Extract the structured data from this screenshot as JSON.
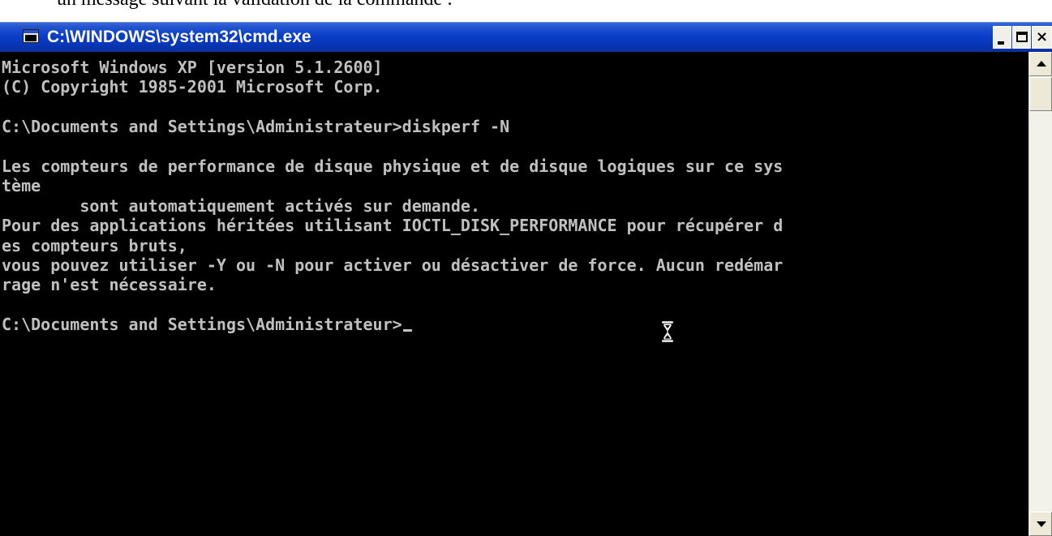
{
  "document": {
    "caption": "un message suivant la validation de la commande :"
  },
  "window": {
    "title": "C:\\WINDOWS\\system32\\cmd.exe",
    "icon": "console-window-icon",
    "controls": {
      "minimize": "minimize-icon",
      "maximize": "maximize-icon",
      "close": "×"
    }
  },
  "console": {
    "lines": [
      "Microsoft Windows XP [version 5.1.2600]",
      "(C) Copyright 1985-2001 Microsoft Corp.",
      "",
      "C:\\Documents and Settings\\Administrateur>diskperf -N",
      "",
      "Les compteurs de performance de disque physique et de disque logiques sur ce sys",
      "tème",
      "        sont automatiquement activés sur demande.",
      "Pour des applications héritées utilisant IOCTL_DISK_PERFORMANCE pour récupérer d",
      "es compteurs bruts,",
      "vous pouvez utiliser -Y ou -N pour activer ou désactiver de force. Aucun redémar",
      "rage n'est nécessaire.",
      "",
      "C:\\Documents and Settings\\Administrateur>"
    ]
  },
  "pointer": "hourglass-icon",
  "colors": {
    "console_text": "#c0c0c0",
    "console_bg": "#000000",
    "titlebar": "#0a3dc9"
  }
}
